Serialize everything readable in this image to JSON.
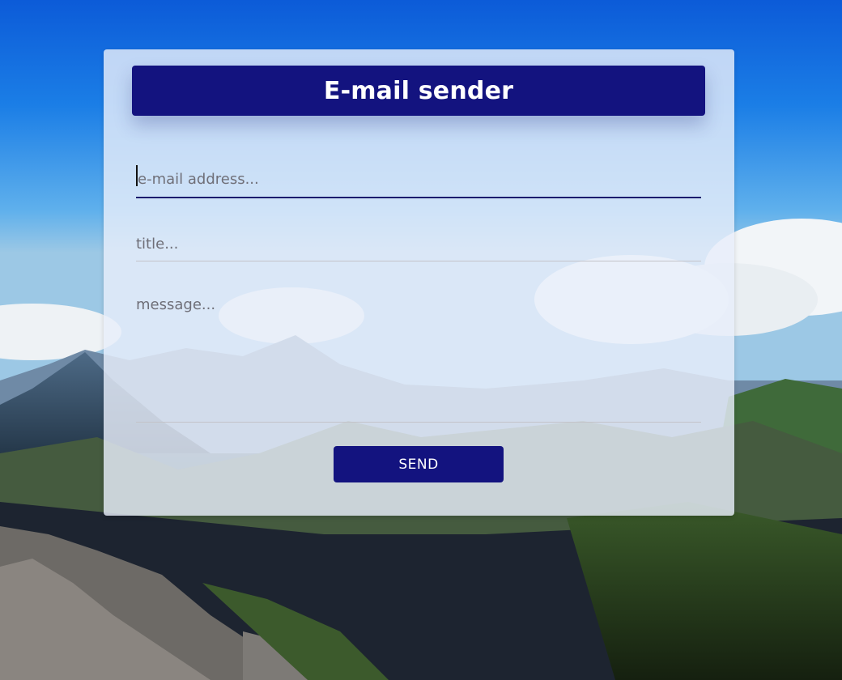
{
  "app": {
    "title": "E-mail sender"
  },
  "form": {
    "email_placeholder": "e-mail address...",
    "email_value": "",
    "title_placeholder": "title...",
    "title_value": "",
    "message_placeholder": "message...",
    "message_value": "",
    "send_label": "SEND"
  },
  "theme": {
    "accent": "#13137f",
    "card_background": "rgba(232,238,250,0.82)",
    "active_underline": "#1c1c6e",
    "inactive_underline": "#c3c3c9"
  },
  "background": {
    "icon": "mountain-landscape-photo"
  }
}
